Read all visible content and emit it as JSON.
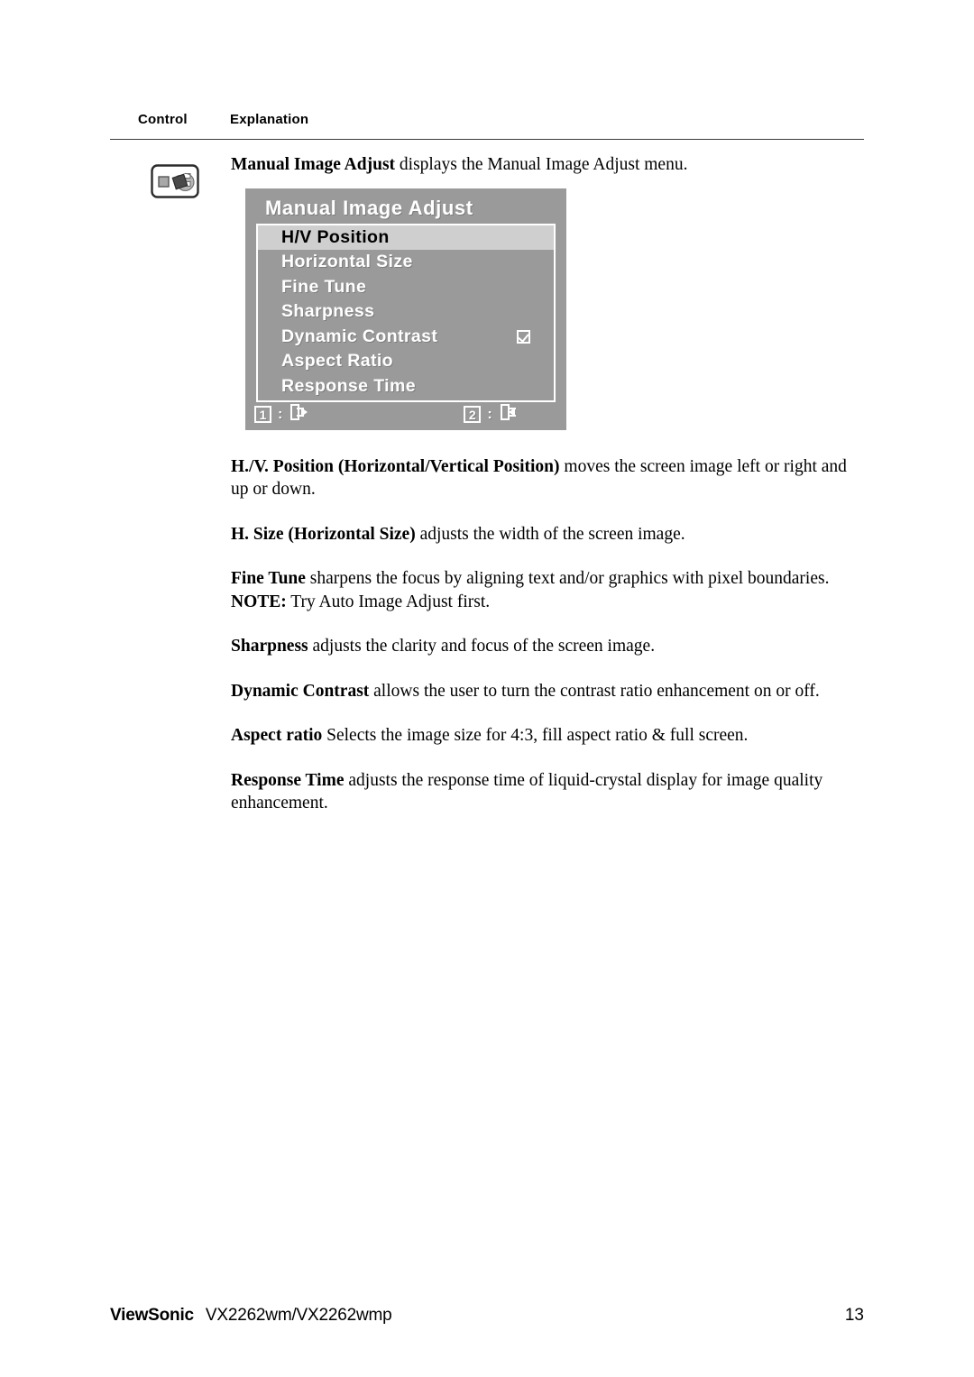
{
  "table_header": {
    "control": "Control",
    "explanation": "Explanation"
  },
  "control_icon": {
    "name": "manual-image-adjust-wrench-icon"
  },
  "explanation": {
    "intro": {
      "bold": "Manual Image Adjust",
      "rest": " displays the Manual Image Adjust menu."
    },
    "paragraphs": [
      {
        "bold": "H./V. Position (Horizontal/Vertical Position)",
        "rest": " moves the screen image left or right and up or down."
      },
      {
        "bold": "H. Size (Horizontal Size)",
        "rest": " adjusts the width of the screen image."
      },
      {
        "bold": "Fine Tune",
        "rest": " sharpens the focus by aligning text and/or graphics with pixel boundaries."
      },
      {
        "bold": "NOTE:",
        "rest": " Try Auto Image Adjust first."
      },
      {
        "bold": "Sharpness",
        "rest": " adjusts the clarity and focus of the screen image."
      },
      {
        "bold": "Dynamic Contrast",
        "rest": " allows the user to turn the contrast ratio enhancement on or off."
      },
      {
        "bold": "Aspect ratio",
        "rest": " Selects the image size for 4:3, fill aspect ratio & full screen."
      },
      {
        "bold": "Response Time",
        "rest": " adjusts the response time of liquid-crystal display for image quality enhancement."
      }
    ]
  },
  "osd": {
    "title": "Manual Image Adjust",
    "items": [
      {
        "label": "H/V Position",
        "selected": true,
        "checkbox": false
      },
      {
        "label": "Horizontal Size",
        "selected": false,
        "checkbox": false
      },
      {
        "label": "Fine Tune",
        "selected": false,
        "checkbox": false
      },
      {
        "label": "Sharpness",
        "selected": false,
        "checkbox": false
      },
      {
        "label": "Dynamic Contrast",
        "selected": false,
        "checkbox": true
      },
      {
        "label": "Aspect Ratio",
        "selected": false,
        "checkbox": false
      },
      {
        "label": "Response Time",
        "selected": false,
        "checkbox": false
      }
    ],
    "hints": [
      {
        "key": "1",
        "separator": ":",
        "icon": "exit-door-arrow-out-icon"
      },
      {
        "key": "2",
        "separator": ":",
        "icon": "enter-door-arrow-in-icon"
      }
    ],
    "colors": {
      "background": "#9a9a9a",
      "selected_row": "#cfcfcf",
      "text": "#ffffff",
      "selected_text": "#000000"
    }
  },
  "footer": {
    "brand": "ViewSonic",
    "model": "VX2262wm/VX2262wmp",
    "page": "13"
  }
}
